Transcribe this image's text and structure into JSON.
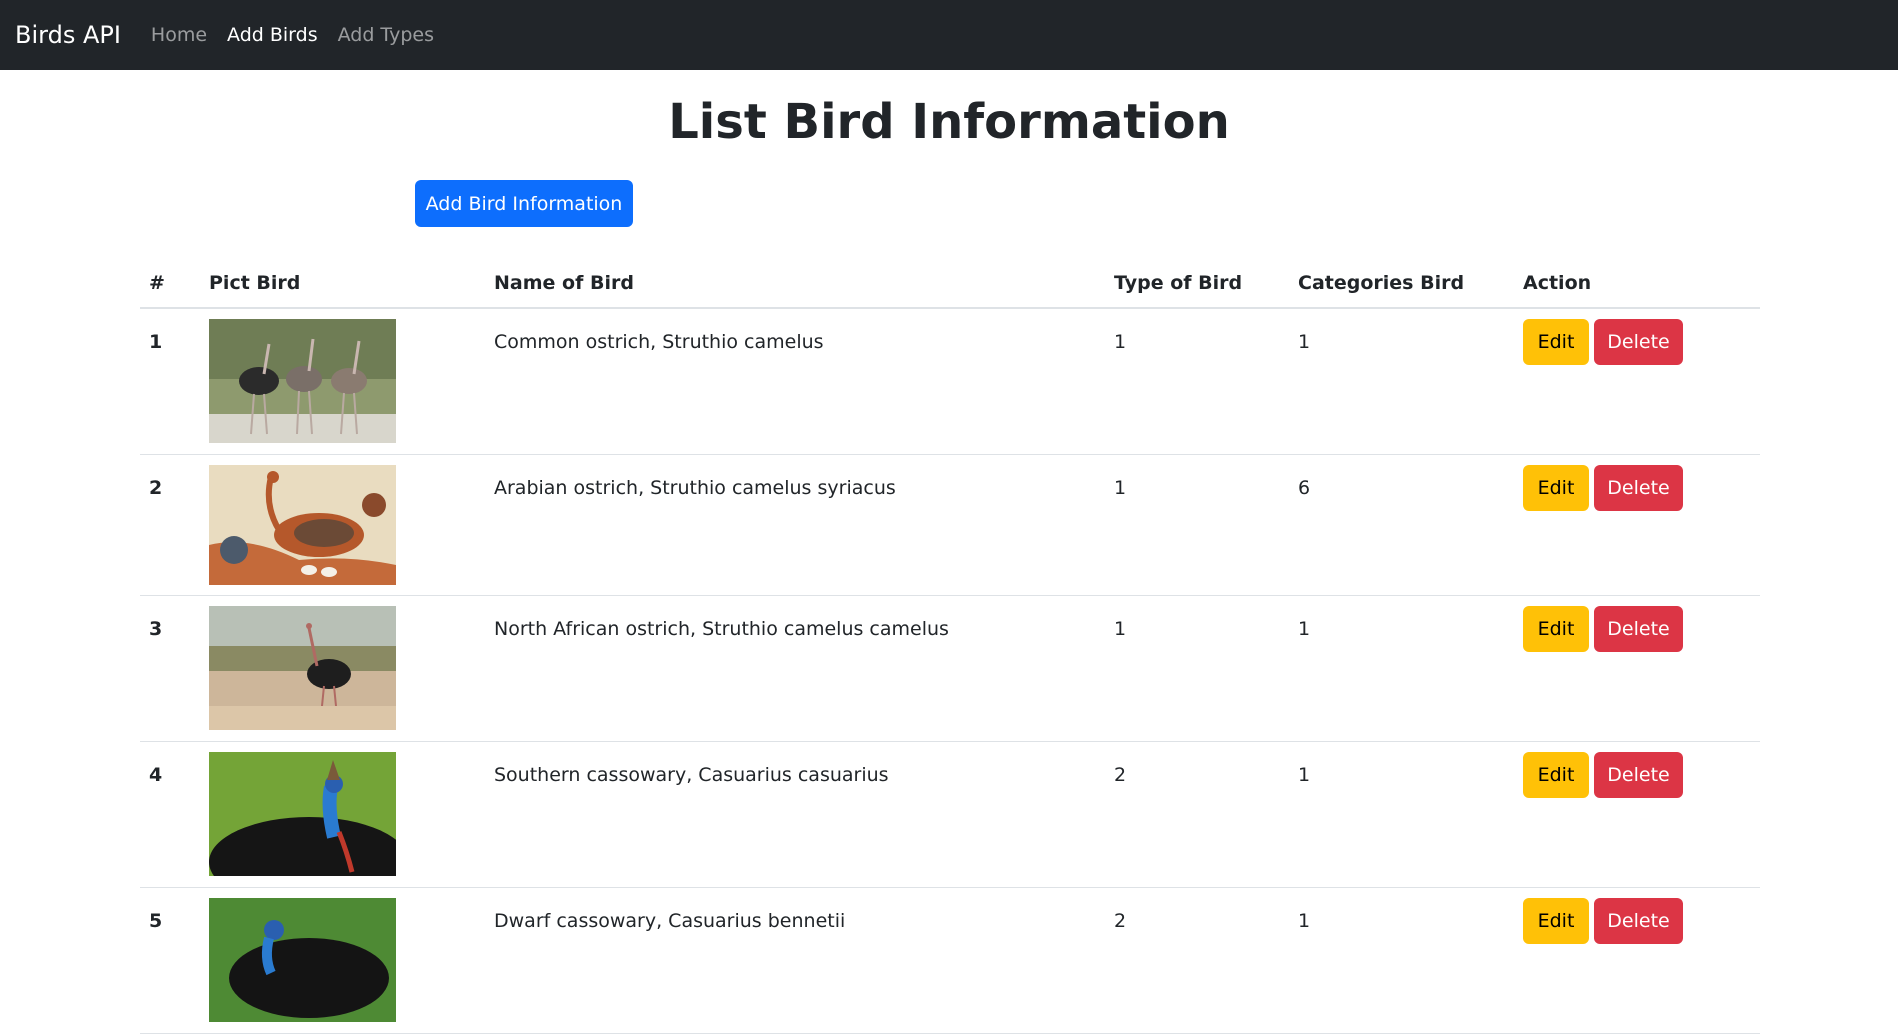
{
  "navbar": {
    "brand": "Birds API",
    "links": [
      {
        "label": "Home"
      },
      {
        "label": "Add Birds"
      },
      {
        "label": "Add Types"
      }
    ]
  },
  "page": {
    "title": "List Bird Information",
    "add_button": "Add Bird Information"
  },
  "table": {
    "headers": [
      "#",
      "Pict Bird",
      "Name of Bird",
      "Type of Bird",
      "Categories Bird",
      "Action"
    ],
    "rows": [
      {
        "num": "1",
        "name": "Common ostrich, Struthio camelus",
        "type": "1",
        "category": "1",
        "edit": "Edit",
        "delete": "Delete"
      },
      {
        "num": "2",
        "name": "Arabian ostrich, Struthio camelus syriacus",
        "type": "1",
        "category": "6",
        "edit": "Edit",
        "delete": "Delete"
      },
      {
        "num": "3",
        "name": "North African ostrich, Struthio camelus camelus",
        "type": "1",
        "category": "1",
        "edit": "Edit",
        "delete": "Delete"
      },
      {
        "num": "4",
        "name": "Southern cassowary, Casuarius casuarius",
        "type": "2",
        "category": "1",
        "edit": "Edit",
        "delete": "Delete"
      },
      {
        "num": "5",
        "name": "Dwarf cassowary, Casuarius bennetii",
        "type": "2",
        "category": "1",
        "edit": "Edit",
        "delete": "Delete"
      }
    ]
  },
  "colors": {
    "navbar_bg": "#212529",
    "primary": "#0d6efd",
    "warning": "#ffc107",
    "danger": "#dc3545"
  }
}
